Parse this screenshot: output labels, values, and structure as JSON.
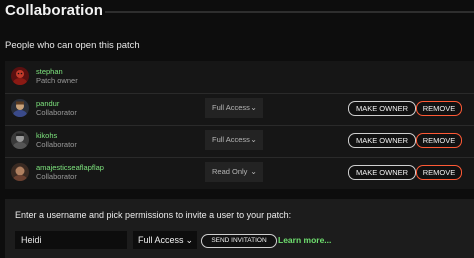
{
  "header": {
    "title": "Collaboration"
  },
  "section": {
    "label": "People who can open this patch"
  },
  "members": [
    {
      "username": "stephan",
      "role": "Patch owner",
      "avatar": "avatar-photo-stephan"
    },
    {
      "username": "pandur",
      "role": "Collaborator",
      "access": "Full Access",
      "make_owner_label": "MAKE OWNER",
      "remove_label": "REMOVE",
      "avatar": "avatar-photo-pandur"
    },
    {
      "username": "kikohs",
      "role": "Collaborator",
      "access": "Full Access",
      "make_owner_label": "MAKE OWNER",
      "remove_label": "REMOVE",
      "avatar": "avatar-photo-kikohs"
    },
    {
      "username": "amajesticseaflapflap",
      "role": "Collaborator",
      "access": "Read Only",
      "make_owner_label": "MAKE OWNER",
      "remove_label": "REMOVE",
      "avatar": "avatar-photo-amajesticseaflapflap"
    }
  ],
  "invite": {
    "label": "Enter a username and pick permissions to invite a user to your patch:",
    "username_value": "Heidi",
    "permission": "Full Access",
    "send_label": "SEND INVITATION",
    "learn_more_label": "Learn more..."
  },
  "colors": {
    "background": "#0d0d0d",
    "username_green": "#7ee57e",
    "remove_border": "#ff5a36",
    "link_green": "#6fe06f"
  }
}
